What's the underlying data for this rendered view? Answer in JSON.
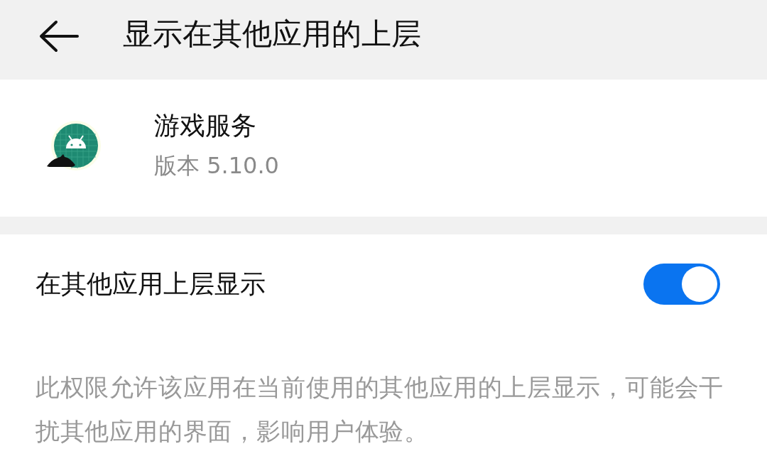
{
  "header": {
    "title": "显示在其他应用的上层"
  },
  "app": {
    "name": "游戏服务",
    "version": "版本 5.10.0"
  },
  "setting": {
    "label": "在其他应用上层显示",
    "on": true
  },
  "description": "此权限允许该应用在当前使用的其他应用的上层显示，可能会干扰其他应用的界面，影响用户体验。"
}
